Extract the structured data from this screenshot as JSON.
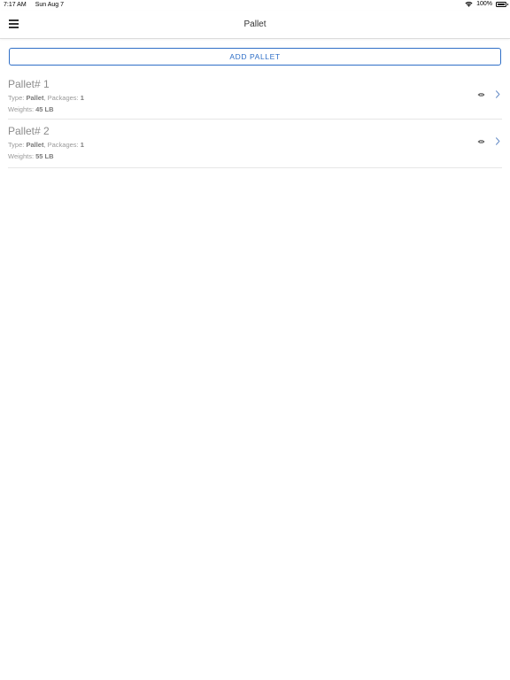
{
  "status_bar": {
    "time": "7:17 AM",
    "date": "Sun Aug 7",
    "battery": "100%",
    "icons": [
      "wifi-icon",
      "battery-icon"
    ]
  },
  "nav": {
    "title": "Pallet",
    "menu_icon": "hamburger-menu-icon"
  },
  "add_button_label": "ADD PALLET",
  "colors": {
    "accent": "#2f6fc7",
    "muted_text": "#8c8c8c",
    "divider": "#e6e6e6"
  },
  "pallets": [
    {
      "title": "Pallet# 1",
      "type_label": "Type: ",
      "type_value": "Pallet",
      "packages_label": ", Packages: ",
      "packages_value": "1",
      "weights_label": "Weights: ",
      "weights_value": "45 LB",
      "icons": [
        "eye-icon",
        "chevron-right-icon"
      ]
    },
    {
      "title": "Pallet# 2",
      "type_label": "Type: ",
      "type_value": "Pallet",
      "packages_label": ", Packages: ",
      "packages_value": "1",
      "weights_label": "Weights: ",
      "weights_value": "55 LB",
      "icons": [
        "eye-icon",
        "chevron-right-icon"
      ]
    }
  ]
}
